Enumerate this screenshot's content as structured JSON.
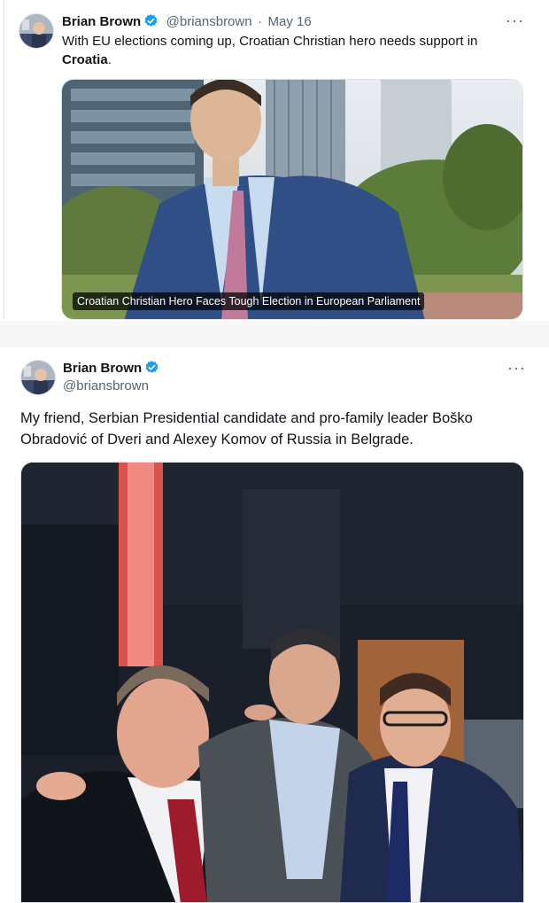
{
  "tweet1": {
    "display_name": "Brian Brown",
    "handle": "@briansbrown",
    "separator": "·",
    "date": "May 16",
    "text_before": "With EU elections coming up, Croatian Christian hero needs support in",
    "text_bold": "Croatia",
    "text_after": ".",
    "media_caption": "Croatian Christian Hero Faces Tough Election in European Parliament",
    "more_icon": "···"
  },
  "tweet2": {
    "display_name": "Brian Brown",
    "handle": "@briansbrown",
    "text_line1": "My friend, Serbian Presidential candidate and pro-family leader Boško",
    "text_line2": "Obradović of Dveri and Alexey Komov of Russia in Belgrade.",
    "more_icon": "···"
  },
  "colors": {
    "verified_blue": "#1d9bf0",
    "text_primary": "#0f1419",
    "text_secondary": "#536471"
  },
  "icons": [
    "verified-badge-icon",
    "more-options-icon"
  ]
}
